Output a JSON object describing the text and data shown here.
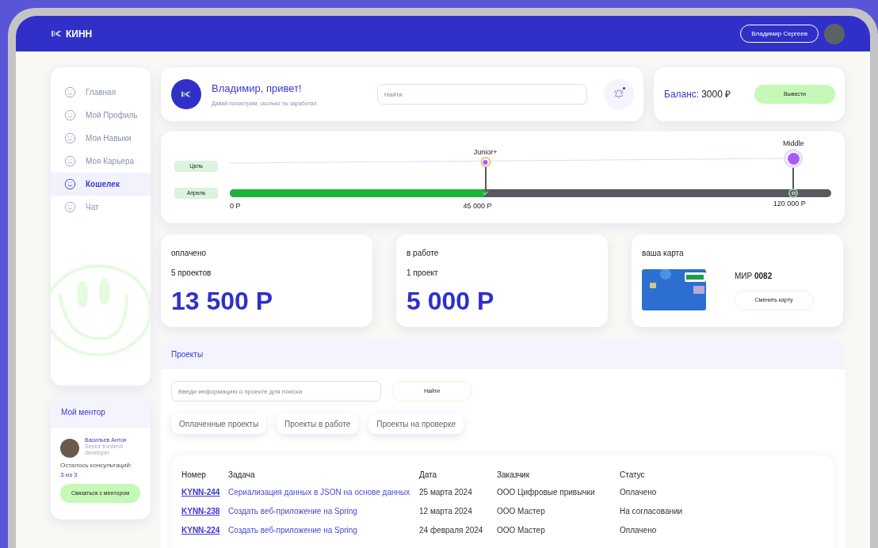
{
  "brand": {
    "name": "КИНН"
  },
  "user": {
    "name": "Владимир Сергеев"
  },
  "sidebar": {
    "items": [
      {
        "label": "Главная",
        "selected": false
      },
      {
        "label": "Мой Профиль",
        "selected": false
      },
      {
        "label": "Мои Навыки",
        "selected": false
      },
      {
        "label": "Моя Карьера",
        "selected": false
      },
      {
        "label": "Кошелек",
        "selected": true
      },
      {
        "label": "Чат",
        "selected": false
      }
    ]
  },
  "mentor": {
    "title": "Мой ментор",
    "name": "Васильев Антон",
    "role": "Senior frontend developer",
    "consultations_label": "Осталось консультаций:",
    "consultations_value": "3 из 3",
    "button": "Связаться с ментором"
  },
  "greeting": {
    "title": "Владимир, привет!",
    "subtitle": "Давай посмотрим, сколько ты заработал",
    "search": {
      "placeholder": "Найти"
    },
    "notifications": {
      "unread": true
    }
  },
  "balance": {
    "label": "Баланс:",
    "amount": "3000 ₽",
    "button": "Вывести"
  },
  "progress": {
    "goal_label": "Цель",
    "current_label": "Апрель",
    "level": 0.425,
    "start_amount": "0 Р",
    "milestones": [
      {
        "title": "Junior+",
        "amount": "45 000 Р",
        "reached": true
      },
      {
        "title": "Middle",
        "amount": "120 000 Р",
        "reached": false
      }
    ]
  },
  "summary": [
    {
      "title": "оплачено",
      "count": "5 проектов",
      "amount": "13 500 Р"
    },
    {
      "title": "в работе",
      "count": "1 проект",
      "amount": "5 000 Р"
    }
  ],
  "card": {
    "title": "ваша карта",
    "name": "МИР **0082**",
    "button": "Сменить карту"
  },
  "projects": {
    "title": "Проекты",
    "search": {
      "placeholder": "Введи информацию о проекте для поиска"
    },
    "search_button": "Найти",
    "filters": [
      {
        "label": "Оплаченные проекты",
        "selected": false
      },
      {
        "label": "Проекты в работе",
        "selected": false
      },
      {
        "label": "Проекты на проверке",
        "selected": false
      }
    ],
    "table": {
      "columns": [
        "Номер",
        "Задача",
        "Дата",
        "Заказчик",
        "Статус"
      ],
      "rows": [
        [
          "KYNN-244",
          "Сериализация данных в JSON на основе данных",
          "25 марта 2024",
          "ООО Цифровые привычки",
          "Оплачено"
        ],
        [
          "KYNN-238",
          "Создать веб-приложение на Spring",
          "12 марта 2024",
          "ООО Мастер",
          "На согласовании"
        ],
        [
          "KYNN-224",
          "Создать веб-приложение на Spring",
          "24 февраля 2024",
          "ООО Мастер",
          "Оплачено"
        ]
      ]
    }
  }
}
